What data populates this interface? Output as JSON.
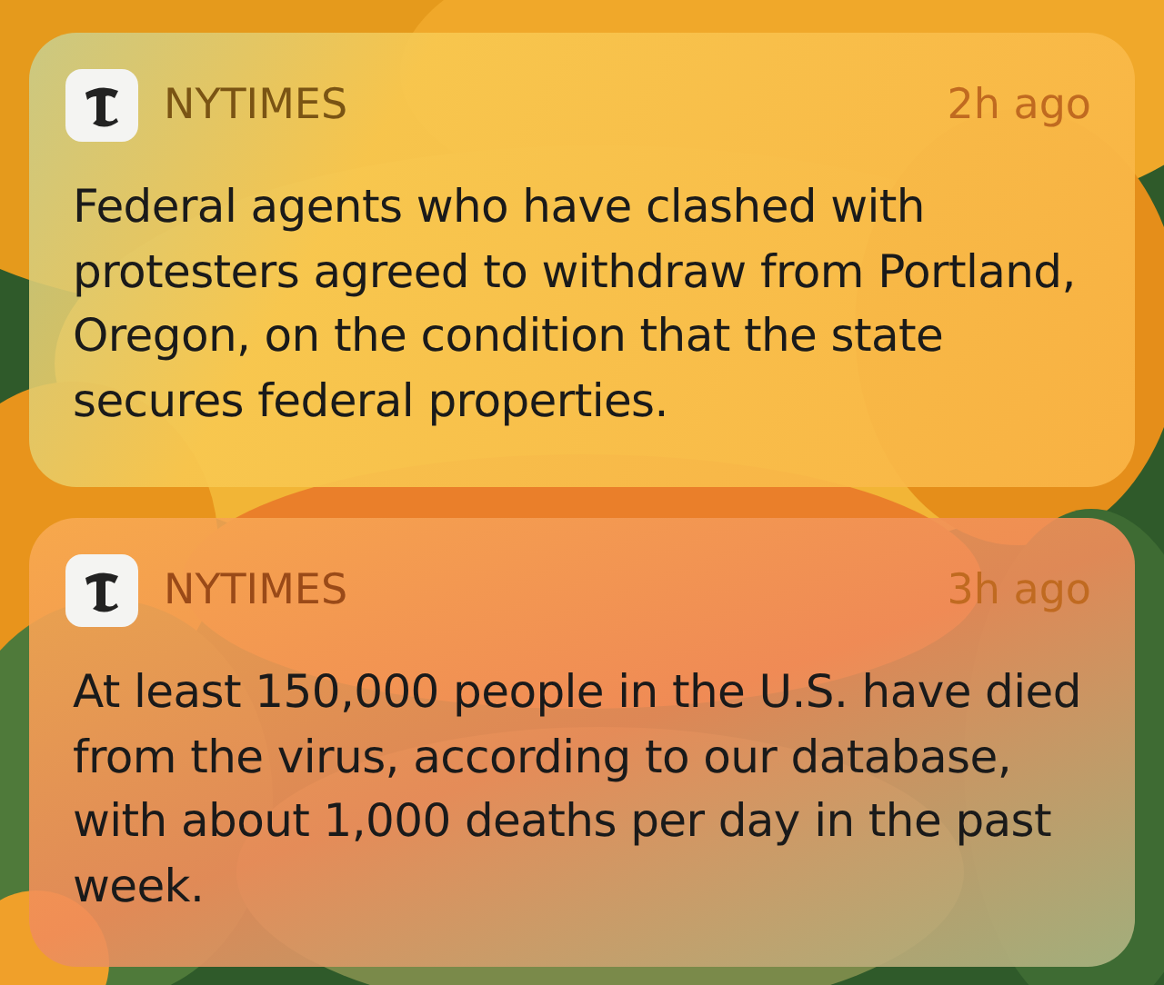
{
  "notifications": [
    {
      "app": "NYTIMES",
      "time": "2h ago",
      "body": "Federal agents who have clashed with protesters agreed to withdraw from Portland, Oregon, on the condition that the state secures federal properties."
    },
    {
      "app": "NYTIMES",
      "time": "3h ago",
      "body": "At least 150,000 people in the U.S. have died from the virus, according to our database, with about 1,000 deaths per day in the past week."
    }
  ]
}
